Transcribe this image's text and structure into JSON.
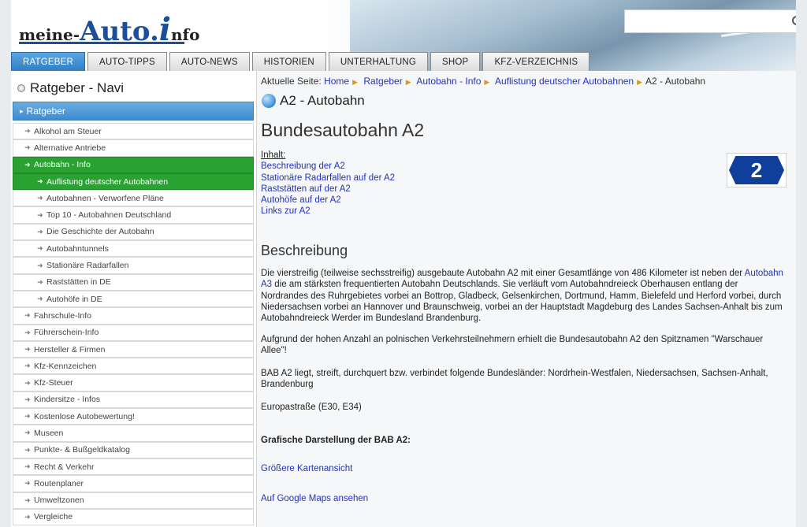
{
  "header": {
    "logo_part1": "meine-",
    "logo_part2": "Auto.",
    "logo_part3": "i",
    "logo_part4": "nfo",
    "search_placeholder": ""
  },
  "nav": {
    "tabs": [
      {
        "label": "RATGEBER",
        "active": true
      },
      {
        "label": "AUTO-TIPPS",
        "active": false
      },
      {
        "label": "AUTO-NEWS",
        "active": false
      },
      {
        "label": "HISTORIEN",
        "active": false
      },
      {
        "label": "UNTERHALTUNG",
        "active": false
      },
      {
        "label": "SHOP",
        "active": false
      },
      {
        "label": "KFZ-VERZEICHNIS",
        "active": false
      }
    ]
  },
  "sidebar": {
    "title": "Ratgeber - Navi",
    "section_label": "Ratgeber",
    "items": [
      {
        "label": "Alkohol am Steuer",
        "sub": false,
        "active": false
      },
      {
        "label": "Alternative Antriebe",
        "sub": false,
        "active": false
      },
      {
        "label": "Autobahn - Info",
        "sub": false,
        "active": true
      },
      {
        "label": "Auflistung deutscher Autobahnen",
        "sub": true,
        "active": true
      },
      {
        "label": "Autobahnen - Verworfene Pläne",
        "sub": true,
        "active": false
      },
      {
        "label": "Top 10 - Autobahnen Deutschland",
        "sub": true,
        "active": false
      },
      {
        "label": "Die Geschichte der Autobahn",
        "sub": true,
        "active": false
      },
      {
        "label": "Autobahntunnels",
        "sub": true,
        "active": false
      },
      {
        "label": "Stationäre Radarfallen",
        "sub": true,
        "active": false
      },
      {
        "label": "Raststätten in DE",
        "sub": true,
        "active": false
      },
      {
        "label": "Autohöfe in DE",
        "sub": true,
        "active": false
      },
      {
        "label": "Fahrschule-Info",
        "sub": false,
        "active": false
      },
      {
        "label": "Führerschein-Info",
        "sub": false,
        "active": false
      },
      {
        "label": "Hersteller & Firmen",
        "sub": false,
        "active": false
      },
      {
        "label": "Kfz-Kennzeichen",
        "sub": false,
        "active": false
      },
      {
        "label": "Kfz-Steuer",
        "sub": false,
        "active": false
      },
      {
        "label": "Kindersitze - Infos",
        "sub": false,
        "active": false
      },
      {
        "label": "Kostenlose Autobewertung!",
        "sub": false,
        "active": false
      },
      {
        "label": "Museen",
        "sub": false,
        "active": false
      },
      {
        "label": "Punkte- & Bußgeldkatalog",
        "sub": false,
        "active": false
      },
      {
        "label": "Recht & Verkehr",
        "sub": false,
        "active": false
      },
      {
        "label": "Routenplaner",
        "sub": false,
        "active": false
      },
      {
        "label": "Umweltzonen",
        "sub": false,
        "active": false
      },
      {
        "label": "Vergleiche",
        "sub": false,
        "active": false
      }
    ]
  },
  "breadcrumb": {
    "prefix": "Aktuelle Seite:",
    "links": [
      "Home",
      "Ratgeber",
      "Autobahn - Info",
      "Auflistung deutscher Autobahnen"
    ],
    "current": "A2 - Autobahn"
  },
  "main": {
    "page_heading": "A2 - Autobahn",
    "title": "Bundesautobahn A2",
    "toc_label": "Inhalt:",
    "toc": [
      "Beschreibung der A2",
      "Stationäre Radarfallen auf der A2",
      "Raststätten auf der A2",
      "Autohöfe auf der A2",
      "Links zur A2"
    ],
    "badge_number": "2",
    "section_title": "Beschreibung",
    "p1_start": "Die vierstreifig (teilweise sechsstreifig) ausgebaute Autobahn A2 mit einer Gesamtlänge von 486 Kilometer ist neben der ",
    "p1_link": "Autobahn A3",
    "p1_end": " die am stärksten frequentierten Autobahn Deutschlands. Sie verläuft vom Autobahndreieck Oberhausen entlang der Nordrandes des Ruhrgebietes vorbei an Bottrop, Gladbeck, Gelsenkirchen, Dortmund, Hamm, Bielefeld und Herford vorbei, durch Niedersachsen vorbei an Hannover und Braunschweig, vorbei an der Hauptstadt Magdeburg des Landes Sachsen-Anhalt bis zum Autobahndreieck Werder im Bundesland Brandenburg.",
    "p2": "Aufgrund der hohen Anzahl an polnischen Verkehrsteilnehmern erhielt die Bundesautobahn A2 den Spitznamen \"Warschauer Allee\"!",
    "p3": "BAB A2 liegt, streift, durchquert bzw. verbindet folgende Bundesländer: Nordrhein-Westfalen, Niedersachsen, Sachsen-Anhalt, Brandenburg",
    "p4": "Europastraße (E30, E34)",
    "p5": "Grafische Darstellung der BAB A2:",
    "link_map": "Größere Kartenansicht",
    "link_google": "Auf Google Maps ansehen"
  }
}
